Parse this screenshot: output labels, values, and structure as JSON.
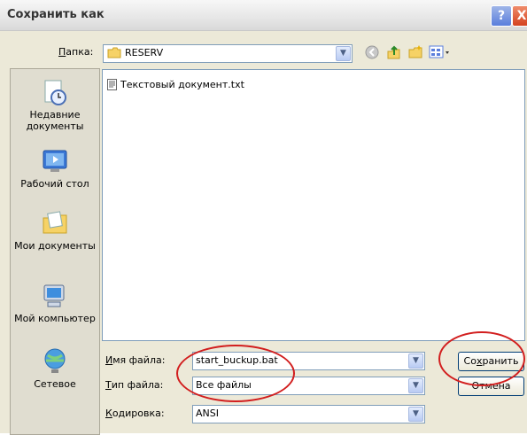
{
  "window": {
    "title": "Сохранить как",
    "help_symbol": "?",
    "close_symbol": "X"
  },
  "toolbar": {
    "folder_label": "Папка:",
    "folder_label_ul": "П",
    "folder_label_rest": "апка:",
    "folder_value": "RESERV"
  },
  "places": [
    {
      "label": "Недавние документы",
      "icon": "recent-documents-icon"
    },
    {
      "label": "Рабочий стол",
      "icon": "desktop-icon"
    },
    {
      "label": "Мои документы",
      "icon": "my-documents-icon"
    },
    {
      "label": "Мой компьютер",
      "icon": "my-computer-icon"
    },
    {
      "label": "Сетевое",
      "icon": "network-icon"
    }
  ],
  "files": [
    {
      "name": "Текстовый документ.txt",
      "icon": "text-file-icon"
    }
  ],
  "form": {
    "filename_label_ul": "И",
    "filename_label_rest": "мя файла:",
    "filename_value": "start_buckup.bat",
    "filetype_label_ul": "Т",
    "filetype_label_rest": "ип файла:",
    "filetype_value": "Все файлы",
    "encoding_label_ul": "К",
    "encoding_label_rest": "одировка:",
    "encoding_value": "ANSI"
  },
  "buttons": {
    "save_pre": "Со",
    "save_ul": "х",
    "save_post": "ранить",
    "cancel": "Отмена"
  },
  "colors": {
    "annotation": "#d21e1e",
    "accent": "#316ac5"
  }
}
